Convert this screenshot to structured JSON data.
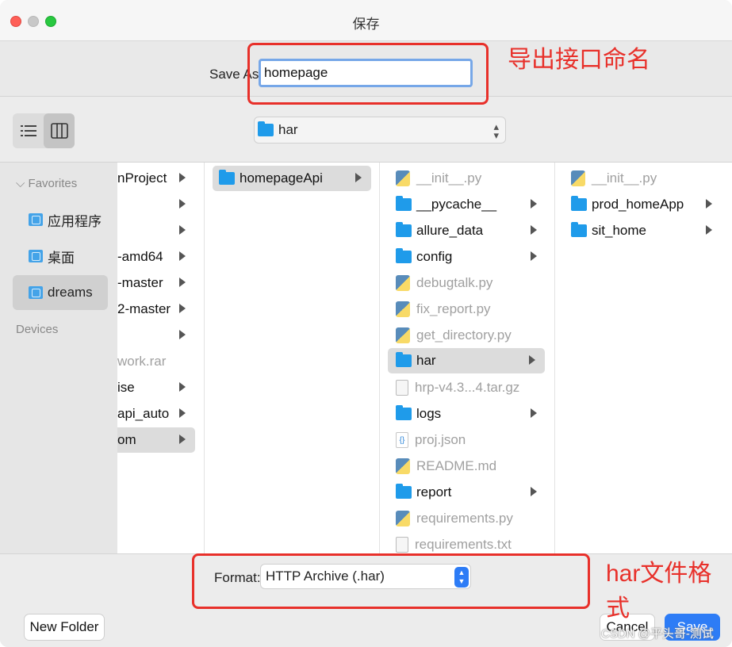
{
  "window": {
    "title": "保存"
  },
  "save_as": {
    "label": "Save As:",
    "value": "homepage"
  },
  "annotations": {
    "save_name_note": "导出接口命名",
    "format_note": "har文件格式"
  },
  "toolbar": {
    "view_list_icon": "list-view-icon",
    "view_column_icon": "column-view-icon",
    "location": "har"
  },
  "sidebar": {
    "favorites_header": "Favorites",
    "items": [
      {
        "label": "应用程序",
        "icon": "applications-folder-icon"
      },
      {
        "label": "桌面",
        "icon": "desktop-folder-icon"
      },
      {
        "label": "dreams",
        "icon": "home-folder-icon",
        "selected": true
      }
    ],
    "devices_header": "Devices"
  },
  "columns": {
    "col1": [
      {
        "label": "nProject",
        "arrow": true
      },
      {
        "label": "",
        "arrow": true
      },
      {
        "label": "",
        "arrow": true
      },
      {
        "label": "-amd64",
        "arrow": true
      },
      {
        "label": "-master",
        "arrow": true
      },
      {
        "label": "2-master",
        "arrow": true
      },
      {
        "label": "",
        "arrow": true
      },
      {
        "label": "work.rar",
        "arrow": false,
        "dim": true
      },
      {
        "label": "ise",
        "arrow": true
      },
      {
        "label": "api_auto",
        "arrow": true
      },
      {
        "label": "om",
        "arrow": true,
        "selected": true
      }
    ],
    "col2": [
      {
        "label": "homepageApi",
        "type": "folder",
        "arrow": true,
        "selected": true
      }
    ],
    "col3": [
      {
        "label": "__init__.py",
        "type": "py",
        "dim": true
      },
      {
        "label": "__pycache__",
        "type": "folder",
        "arrow": true
      },
      {
        "label": "allure_data",
        "type": "folder",
        "arrow": true
      },
      {
        "label": "config",
        "type": "folder",
        "arrow": true
      },
      {
        "label": "debugtalk.py",
        "type": "py",
        "dim": true
      },
      {
        "label": "fix_report.py",
        "type": "py",
        "dim": true
      },
      {
        "label": "get_directory.py",
        "type": "py",
        "dim": true
      },
      {
        "label": "har",
        "type": "folder",
        "arrow": true,
        "selected": true
      },
      {
        "label": "hrp-v4.3...4.tar.gz",
        "type": "doc",
        "dim": true
      },
      {
        "label": "logs",
        "type": "folder",
        "arrow": true
      },
      {
        "label": "proj.json",
        "type": "json",
        "dim": true
      },
      {
        "label": "README.md",
        "type": "py",
        "dim": true
      },
      {
        "label": "report",
        "type": "folder",
        "arrow": true
      },
      {
        "label": "requirements.py",
        "type": "py",
        "dim": true
      },
      {
        "label": "requirements.txt",
        "type": "doc",
        "dim": true
      }
    ],
    "col4": [
      {
        "label": "__init__.py",
        "type": "py",
        "dim": true
      },
      {
        "label": "prod_homeApp",
        "type": "folder",
        "arrow": true
      },
      {
        "label": "sit_home",
        "type": "folder",
        "arrow": true
      }
    ]
  },
  "format": {
    "label": "Format:",
    "value": "HTTP Archive (.har)"
  },
  "buttons": {
    "new_folder": "New Folder",
    "cancel": "Cancel",
    "save": "Save"
  },
  "watermark": "CSDN @平头哥-测试",
  "colors": {
    "accent": "#2d7cf6",
    "annotation": "#e8302a",
    "folder": "#1f9bea"
  }
}
